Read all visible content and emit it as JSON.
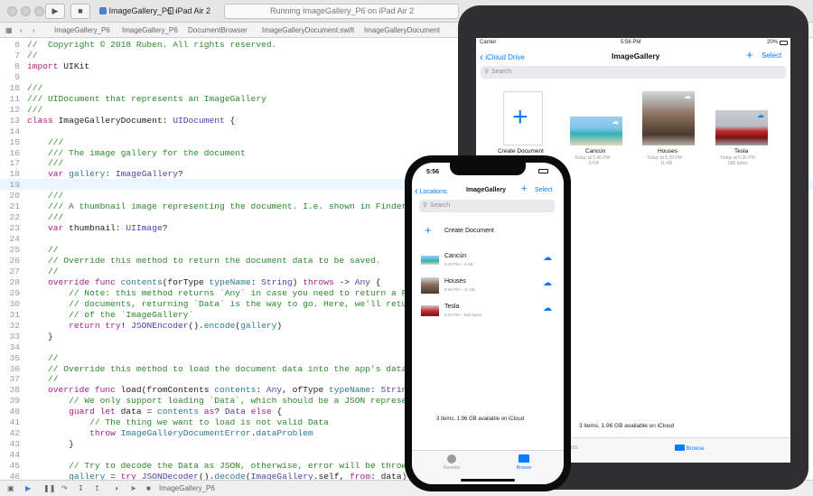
{
  "toolbar": {
    "scheme_target": "ImageGallery_P6",
    "scheme_device": "iPad Air 2",
    "status": "Running ImageGallery_P6 on iPad Air 2"
  },
  "jumpbar": {
    "items": [
      "ImageGallery_P6",
      "ImageGallery_P6",
      "DocumentBrowser",
      "ImageGalleryDocument.swift",
      "ImageGalleryDocument"
    ]
  },
  "editor": {
    "lines": [
      {
        "n": "6",
        "t": "//  Copyright © 2018 Ruben. All rights reserved."
      },
      {
        "n": "7",
        "t": "//"
      },
      {
        "n": "8",
        "t": "import UIKit"
      },
      {
        "n": "9",
        "t": ""
      },
      {
        "n": "10",
        "t": "///"
      },
      {
        "n": "11",
        "t": "/// UIDocument that represents an ImageGallery"
      },
      {
        "n": "12",
        "t": "///"
      },
      {
        "n": "13",
        "t": "class ImageGalleryDocument: UIDocument {"
      },
      {
        "n": "14",
        "t": ""
      },
      {
        "n": "15",
        "t": "    ///"
      },
      {
        "n": "16",
        "t": "    /// The image gallery for the document"
      },
      {
        "n": "17",
        "t": "    ///"
      },
      {
        "n": "18",
        "t": "    var gallery: ImageGallery?"
      },
      {
        "n": "19",
        "t": ""
      },
      {
        "n": "20",
        "t": "    ///"
      },
      {
        "n": "21",
        "t": "    /// A thumbnail image representing the document. I.e. shown in Finder, as"
      },
      {
        "n": "22",
        "t": "    ///"
      },
      {
        "n": "23",
        "t": "    var thumbnail: UIImage?"
      },
      {
        "n": "24",
        "t": ""
      },
      {
        "n": "25",
        "t": "    //"
      },
      {
        "n": "26",
        "t": "    // Override this method to return the document data to be saved."
      },
      {
        "n": "27",
        "t": "    //"
      },
      {
        "n": "28",
        "t": "    override func contents(forType typeName: String) throws -> Any {"
      },
      {
        "n": "29",
        "t": "        // Note: this method returns `Any` in case you need to return a FileWr"
      },
      {
        "n": "30",
        "t": "        // documents, returning `Data` is the way to go. Here, we'll return a"
      },
      {
        "n": "31",
        "t": "        // of the `ImageGallery`"
      },
      {
        "n": "32",
        "t": "        return try! JSONEncoder().encode(gallery)"
      },
      {
        "n": "33",
        "t": "    }"
      },
      {
        "n": "34",
        "t": ""
      },
      {
        "n": "35",
        "t": "    //"
      },
      {
        "n": "36",
        "t": "    // Override this method to load the document data into the app's data mode"
      },
      {
        "n": "37",
        "t": "    //"
      },
      {
        "n": "38",
        "t": "    override func load(fromContents contents: Any, ofType typeName: String?) t"
      },
      {
        "n": "39",
        "t": "        // We only support loading `Data`, which should be a JSON representati"
      },
      {
        "n": "40",
        "t": "        guard let data = contents as? Data else {"
      },
      {
        "n": "41",
        "t": "            // The thing we want to load is not valid Data"
      },
      {
        "n": "42",
        "t": "            throw ImageGalleryDocumentError.dataProblem"
      },
      {
        "n": "43",
        "t": "        }"
      },
      {
        "n": "44",
        "t": ""
      },
      {
        "n": "45",
        "t": "        // Try to decode the Data as JSON, otherwise, error will be thrown to"
      },
      {
        "n": "46",
        "t": "        gallery = try JSONDecoder().decode(ImageGallery.self, from: data)"
      }
    ]
  },
  "debug_bar": {
    "target": "ImageGallery_P6"
  },
  "ipad": {
    "status_left": "Carrier",
    "status_time": "5:56 PM",
    "status_battery": "20%",
    "back_label": "iCloud Drive",
    "title": "ImageGallery",
    "select_label": "Select",
    "search_placeholder": "Search",
    "create_label": "Create Document",
    "documents": [
      {
        "name": "Cancún",
        "date": "Today at 5:40 PM",
        "size": "6 KB"
      },
      {
        "name": "Houses",
        "date": "Today at 5:39 PM",
        "size": "11 KB"
      },
      {
        "name": "Tesla",
        "date": "Today at 5:36 PM",
        "size": "685 bytes"
      }
    ],
    "footer": "3 items, 1.96 GB available on iCloud",
    "tabs": [
      "Recents",
      "Browse"
    ]
  },
  "iphone": {
    "status_time": "5:56",
    "back_label": "Locations",
    "title": "ImageGallery",
    "select_label": "Select",
    "search_placeholder": "Search",
    "create_label": "Create Document",
    "documents": [
      {
        "name": "Cancún",
        "meta": "5:40 PM – 6 KB"
      },
      {
        "name": "Houses",
        "meta": "5:39 PM – 11 KB"
      },
      {
        "name": "Tesla",
        "meta": "5:36 PM – 685 bytes"
      }
    ],
    "footer": "3 items, 1.96 GB available on iCloud",
    "tabs": [
      "Recents",
      "Browse"
    ]
  },
  "colors": {
    "accent": "#0a7cff",
    "comment": "#2a8a2a",
    "keyword": "#ab1d8e",
    "type": "#4d3ea8"
  }
}
